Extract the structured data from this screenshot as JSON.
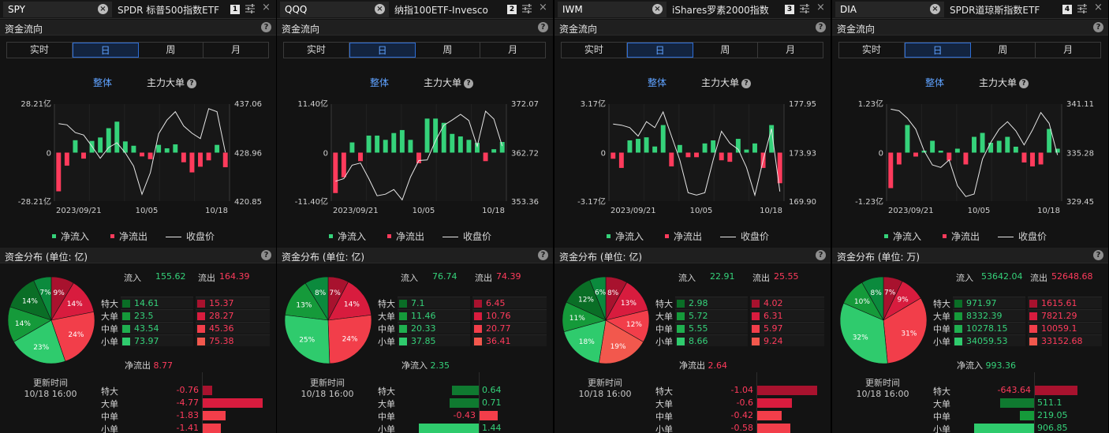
{
  "labels": {
    "flow_section": "资金流向",
    "dist_prefix": "资金分布 (单位: ",
    "dist_suffix": ")",
    "tabs": [
      "实时",
      "日",
      "周",
      "月"
    ],
    "whole": "整体",
    "main_big": "主力大单",
    "legend_in": "净流入",
    "legend_out": "净流出",
    "legend_close": "收盘价",
    "inflow": "流入",
    "outflow": "流出",
    "rows": [
      "特大",
      "大单",
      "中单",
      "小单"
    ],
    "update_label": "更新时间",
    "update_time": "10/18 16:00",
    "x_labels": [
      "2023/09/21",
      "10/05",
      "10/18"
    ],
    "zero": "0",
    "help": "?",
    "close": "×"
  },
  "colors": {
    "green": "#35d27a",
    "red": "#ff3b5c",
    "pie_green": [
      "#2fcb6d",
      "#159a3a",
      "#0a6e26",
      "#0b8a3d"
    ],
    "pie_red": [
      "#a8122e",
      "#d81c3e",
      "#f23e4a",
      "#f2584d"
    ],
    "blue": "#5fa2ff"
  },
  "panels": [
    {
      "ticker": "SPY",
      "name": "SPDR 标普500指数ETF",
      "num": "1",
      "unit": "亿",
      "chart_data": {
        "type": "bar+line",
        "yleft": {
          "max": "28.21亿",
          "zero": "0",
          "min": "-28.21亿",
          "range": [
            -28.21,
            28.21
          ]
        },
        "yright": {
          "top": "437.06",
          "mid": "428.96",
          "bottom": "420.85",
          "range": [
            420.85,
            437.06
          ]
        },
        "x_labels": [
          "2023/09/21",
          "10/05",
          "10/18"
        ],
        "net_flow": [
          -22.5,
          -7.6,
          7.2,
          -3.5,
          6.8,
          8.8,
          14.2,
          18.0,
          6.5,
          4.0,
          -2.2,
          -3.8,
          4.5,
          2.5,
          4.8,
          -5.6,
          -11.5,
          -8.2,
          -4.5,
          4.5,
          -8.5
        ],
        "close": [
          433.8,
          433.6,
          432.3,
          431.9,
          430.0,
          428.0,
          429.8,
          430.6,
          428.9,
          426.7,
          422.0,
          425.6,
          432.1,
          434.4,
          435.8,
          433.4,
          432.2,
          431.3,
          436.3,
          435.8,
          429.0
        ]
      },
      "dist": {
        "in_total": "155.62",
        "out_total": "164.39",
        "in": [
          "14.61",
          "23.5",
          "43.54",
          "73.97"
        ],
        "out": [
          "15.37",
          "28.27",
          "45.36",
          "75.38"
        ],
        "pie_in_pct": [
          7,
          14,
          14,
          23
        ],
        "pie_out_pct": [
          9,
          14,
          24
        ],
        "pie_out_small_pct": 0,
        "net_label": "净流出",
        "net_total": "8.77",
        "net_sign": "out",
        "net": [
          -0.76,
          -4.77,
          -1.83,
          -1.41
        ],
        "net_text": [
          "-0.76",
          "-4.77",
          "-1.83",
          "-1.41"
        ]
      }
    },
    {
      "ticker": "QQQ",
      "name": "纳指100ETF-Invesco",
      "num": "2",
      "unit": "亿",
      "chart_data": {
        "type": "bar+line",
        "yleft": {
          "max": "11.40亿",
          "zero": "0",
          "min": "-11.40亿",
          "range": [
            -11.4,
            11.4
          ]
        },
        "yright": {
          "top": "372.07",
          "mid": "362.72",
          "bottom": "353.36",
          "range": [
            353.36,
            372.07
          ]
        },
        "x_labels": [
          "2023/09/21",
          "10/05",
          "10/18"
        ],
        "net_flow": [
          -9.5,
          -5.8,
          2.4,
          -2.0,
          4.0,
          4.0,
          3.0,
          4.6,
          5.3,
          3.0,
          -2.5,
          8.0,
          8.0,
          7.0,
          4.4,
          3.8,
          3.0,
          2.3,
          -2.0,
          0.8,
          2.5
        ],
        "close": [
          357.2,
          357.7,
          360.3,
          360.7,
          357.7,
          354.4,
          354.7,
          355.6,
          353.6,
          358.0,
          361.2,
          361.3,
          365.0,
          368.0,
          369.0,
          370.1,
          368.9,
          363.9,
          370.7,
          369.2,
          364.0
        ]
      },
      "dist": {
        "in_total": "76.74",
        "out_total": "74.39",
        "in": [
          "7.1",
          "11.46",
          "20.33",
          "37.85"
        ],
        "out": [
          "6.45",
          "10.76",
          "20.77",
          "36.41"
        ],
        "pie_in_pct": [
          8,
          13,
          25
        ],
        "pie_out_pct": [
          7,
          14,
          24
        ],
        "net_label": "净流入",
        "net_total": "2.35",
        "net_sign": "in",
        "net": [
          0.64,
          0.71,
          -0.43,
          1.44
        ],
        "net_text": [
          "0.64",
          "0.71",
          "-0.43",
          "1.44"
        ]
      }
    },
    {
      "ticker": "IWM",
      "name": "iShares罗素2000指数",
      "num": "3",
      "unit": "亿",
      "chart_data": {
        "type": "bar+line",
        "yleft": {
          "max": "3.17亿",
          "zero": "0",
          "min": "-3.17亿",
          "range": [
            -3.17,
            3.17
          ]
        },
        "yright": {
          "top": "177.95",
          "mid": "173.93",
          "bottom": "169.90",
          "range": [
            169.9,
            177.95
          ]
        },
        "x_labels": [
          "2023/09/21",
          "10/05",
          "10/18"
        ],
        "net_flow": [
          -0.4,
          -1.0,
          0.8,
          0.9,
          1.0,
          0.4,
          1.8,
          -0.9,
          0.5,
          -0.3,
          -0.3,
          0.6,
          0.8,
          -0.5,
          -0.6,
          0.9,
          0.2,
          0.6,
          -1.0,
          1.8,
          -2.0
        ],
        "close": [
          176.3,
          176.2,
          176.0,
          175.3,
          176.5,
          176.0,
          177.3,
          175.3,
          173.3,
          170.6,
          170.4,
          170.6,
          173.3,
          175.7,
          174.7,
          174.2,
          172.7,
          170.4,
          173.3,
          175.9,
          170.7
        ]
      },
      "dist": {
        "in_total": "22.91",
        "out_total": "25.55",
        "in": [
          "2.98",
          "5.72",
          "5.55",
          "8.66"
        ],
        "out": [
          "4.02",
          "6.31",
          "5.97",
          "9.24"
        ],
        "pie_in_pct": [
          6,
          12,
          11,
          18
        ],
        "pie_out_pct": [
          8,
          13,
          12,
          19
        ],
        "net_label": "净流出",
        "net_total": "2.64",
        "net_sign": "out",
        "net": [
          -1.04,
          -0.6,
          -0.42,
          -0.58
        ],
        "net_text": [
          "-1.04",
          "-0.6",
          "-0.42",
          "-0.58"
        ]
      }
    },
    {
      "ticker": "DIA",
      "name": "SPDR道琼斯指数ETF",
      "num": "4",
      "unit": "万",
      "chart_data": {
        "type": "bar+line",
        "yleft": {
          "max": "1.23亿",
          "zero": "0",
          "min": "-1.23亿",
          "range": [
            -1.23,
            1.23
          ]
        },
        "yright": {
          "top": "341.11",
          "mid": "335.28",
          "bottom": "329.45",
          "range": [
            329.45,
            341.11
          ]
        },
        "x_labels": [
          "2023/09/21",
          "10/05",
          "10/18"
        ],
        "net_flow": [
          -0.9,
          -0.3,
          0.7,
          -0.1,
          0.05,
          0.3,
          0.05,
          -0.2,
          0.1,
          -0.3,
          0.4,
          0.5,
          0.25,
          0.3,
          0.4,
          0.15,
          -0.25,
          -0.35,
          -0.3,
          0.6,
          0.1
        ],
        "close": [
          340.5,
          340.3,
          339.4,
          338.1,
          335.5,
          333.8,
          333.5,
          334.4,
          331.3,
          330.0,
          330.3,
          334.5,
          336.5,
          338.1,
          339.0,
          337.9,
          336.2,
          338.0,
          340.1,
          338.8,
          335.0
        ]
      },
      "dist": {
        "in_total": "53642.04",
        "out_total": "52648.68",
        "in": [
          "971.97",
          "8332.39",
          "10278.15",
          "34059.53"
        ],
        "out": [
          "1615.61",
          "7821.29",
          "10059.1",
          "33152.68"
        ],
        "pie_in_pct": [
          8,
          10,
          32
        ],
        "pie_out_pct": [
          7,
          9,
          31
        ],
        "net_label": "净流入",
        "net_total": "993.36",
        "net_sign": "in",
        "net": [
          -643.64,
          511.1,
          219.05,
          906.85
        ],
        "net_text": [
          "-643.64",
          "511.1",
          "219.05",
          "906.85"
        ]
      }
    }
  ]
}
